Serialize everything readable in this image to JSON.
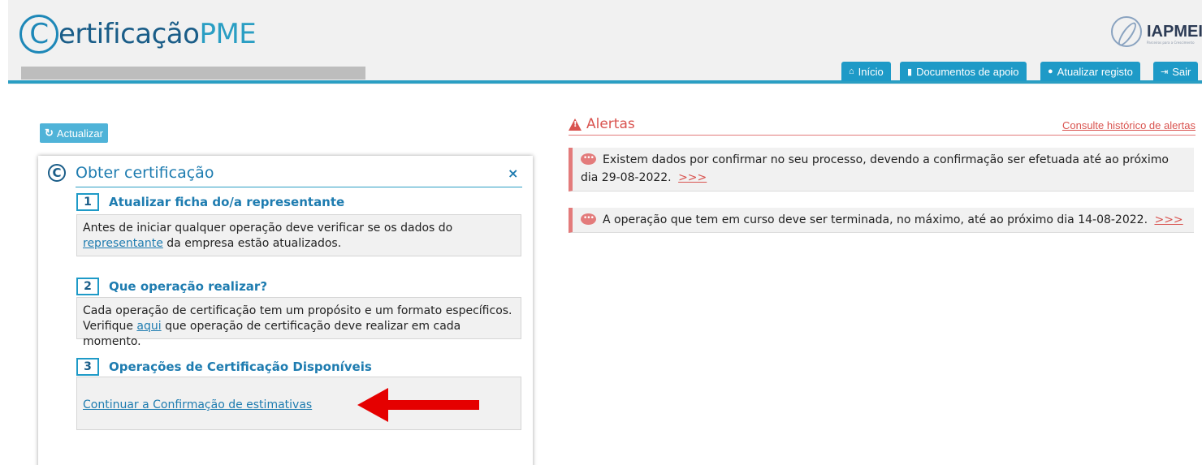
{
  "header": {
    "logo_part1": "ertificação",
    "logo_part2": "PME",
    "logo_c": "C",
    "iapmei_text": "IAPMEI",
    "iapmei_sub": "Parceiros para a Crescimento",
    "nav": [
      {
        "label": "Início",
        "icon": "home-icon"
      },
      {
        "label": "Documentos de apoio",
        "icon": "book-icon"
      },
      {
        "label": "Atualizar registo",
        "icon": "user-icon"
      },
      {
        "label": "Sair",
        "icon": "sign-out-icon"
      }
    ]
  },
  "refresh_button": "Actualizar",
  "panel": {
    "title": "Obter certificação",
    "close": "×",
    "steps": [
      {
        "num": "1",
        "title": "Atualizar ficha do/a representante",
        "text_before": "Antes de iniciar qualquer operação deve verificar se os dados do",
        "link": "representante",
        "text_after": "da empresa estão atualizados."
      },
      {
        "num": "2",
        "title": "Que operação realizar?",
        "text_line1": "Cada operação de certificação tem um propósito e um formato específicos.",
        "text_before": "Verifique",
        "link": "aqui",
        "text_after": "que operação de certificação deve realizar em cada momento."
      },
      {
        "num": "3",
        "title": "Operações de Certificação Disponíveis",
        "link": "Continuar a Confirmação de estimativas"
      }
    ]
  },
  "alerts": {
    "title": "Alertas",
    "history_link": "Consulte histórico de alertas",
    "items": [
      {
        "text": "Existem dados por confirmar no seu processo, devendo a confirmação ser efetuada até ao próximo dia 29-08-2022.",
        "more": ">>>"
      },
      {
        "text": "A operação que tem em curso deve ser terminada, no máximo, até ao próximo dia 14-08-2022.",
        "more": ">>>"
      }
    ]
  },
  "colors": {
    "accent": "#1e9ac7",
    "alert": "#d9534f",
    "arrow": "#e50000"
  }
}
